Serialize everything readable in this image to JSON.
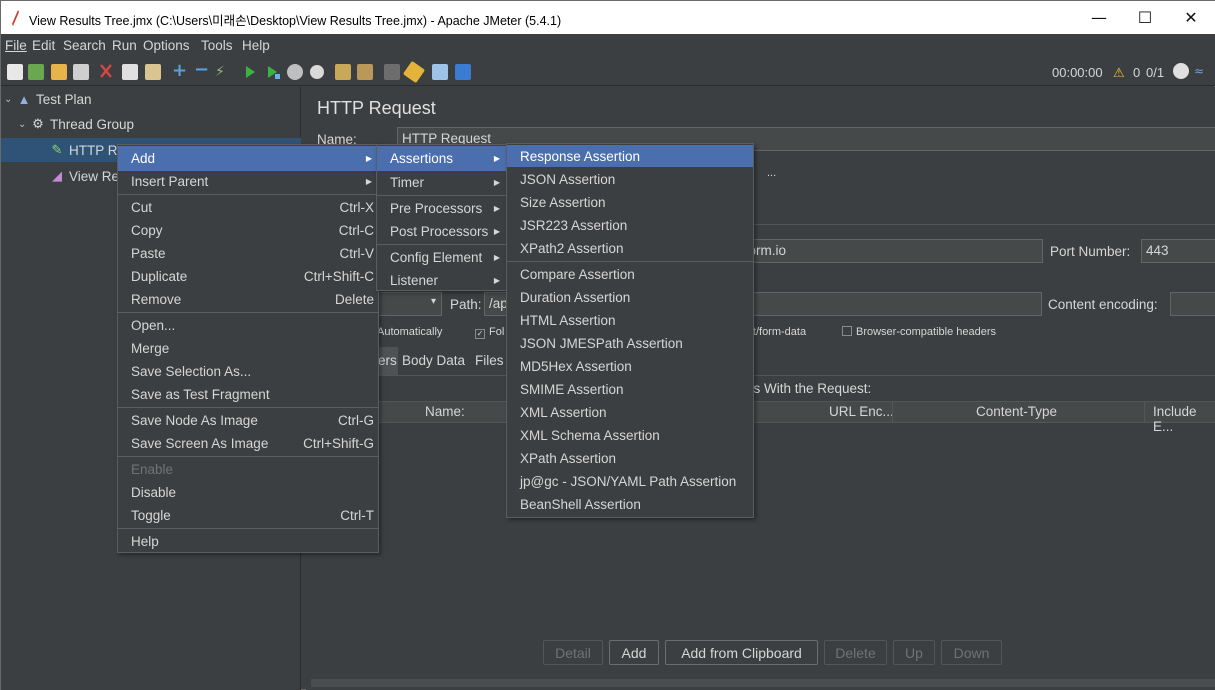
{
  "window": {
    "title": "View Results Tree.jmx (C:\\Users\\미래손\\Desktop\\View Results Tree.jmx) - Apache JMeter (5.4.1)",
    "minimize": "—",
    "maximize": "☐",
    "close": "✕"
  },
  "menubar": [
    "File",
    "Edit",
    "Search",
    "Run",
    "Options",
    "Tools",
    "Help"
  ],
  "toolbar": {
    "timer": "00:00:00",
    "warnings": "0",
    "threads": "0/1"
  },
  "tree": {
    "items": [
      {
        "label": "Test Plan"
      },
      {
        "label": "Thread Group"
      },
      {
        "label": "HTTP Re"
      },
      {
        "label": "View Re"
      }
    ]
  },
  "main": {
    "title": "HTTP Request",
    "name_label": "Name:",
    "name_value": "HTTP Request",
    "ellipsis": "...",
    "server_value": "porm.io",
    "port_label": "Port Number:",
    "port_value": "443",
    "path_label": "Path:",
    "path_value": "/ap",
    "content_encoding_label": "Content encoding:",
    "opt_redirect_auto": "ct Automatically",
    "opt_follow": "Fol",
    "opt_multipart": "part/form-data",
    "opt_browser_headers": "Browser-compatible headers",
    "tab_params": "ers",
    "tab_body": "Body Data",
    "tab_files": "Files",
    "send_params_label": "rs With the Request:",
    "columns": [
      "Name:",
      "URL Enc...",
      "Content-Type",
      "Include E..."
    ],
    "buttons": {
      "detail": "Detail",
      "add": "Add",
      "add_clipboard": "Add from Clipboard",
      "delete": "Delete",
      "up": "Up",
      "down": "Down"
    }
  },
  "context_menu": {
    "items": [
      {
        "label": "Add",
        "shortcut": "",
        "submenu": true
      },
      {
        "label": "Insert Parent",
        "shortcut": "",
        "submenu": true
      },
      {
        "label": "Cut",
        "shortcut": "Ctrl-X"
      },
      {
        "label": "Copy",
        "shortcut": "Ctrl-C"
      },
      {
        "label": "Paste",
        "shortcut": "Ctrl-V"
      },
      {
        "label": "Duplicate",
        "shortcut": "Ctrl+Shift-C"
      },
      {
        "label": "Remove",
        "shortcut": "Delete"
      },
      {
        "label": "Open..."
      },
      {
        "label": "Merge"
      },
      {
        "label": "Save Selection As..."
      },
      {
        "label": "Save as Test Fragment"
      },
      {
        "label": "Save Node As Image",
        "shortcut": "Ctrl-G"
      },
      {
        "label": "Save Screen As Image",
        "shortcut": "Ctrl+Shift-G"
      },
      {
        "label": "Enable"
      },
      {
        "label": "Disable"
      },
      {
        "label": "Toggle",
        "shortcut": "Ctrl-T"
      },
      {
        "label": "Help"
      }
    ]
  },
  "add_submenu": {
    "items": [
      "Assertions",
      "Timer",
      "Pre Processors",
      "Post Processors",
      "Config Element",
      "Listener"
    ]
  },
  "assertions_submenu": {
    "items": [
      "Response Assertion",
      "JSON Assertion",
      "Size Assertion",
      "JSR223 Assertion",
      "XPath2 Assertion",
      "Compare Assertion",
      "Duration Assertion",
      "HTML Assertion",
      "JSON JMESPath Assertion",
      "MD5Hex Assertion",
      "SMIME Assertion",
      "XML Assertion",
      "XML Schema Assertion",
      "XPath Assertion",
      "jp@gc - JSON/YAML Path Assertion",
      "BeanShell Assertion"
    ]
  },
  "colors": {
    "background": "#3c3f41",
    "selection": "#2f5377",
    "menu_highlight": "#4b6eaf",
    "text": "#d6d6d6"
  }
}
